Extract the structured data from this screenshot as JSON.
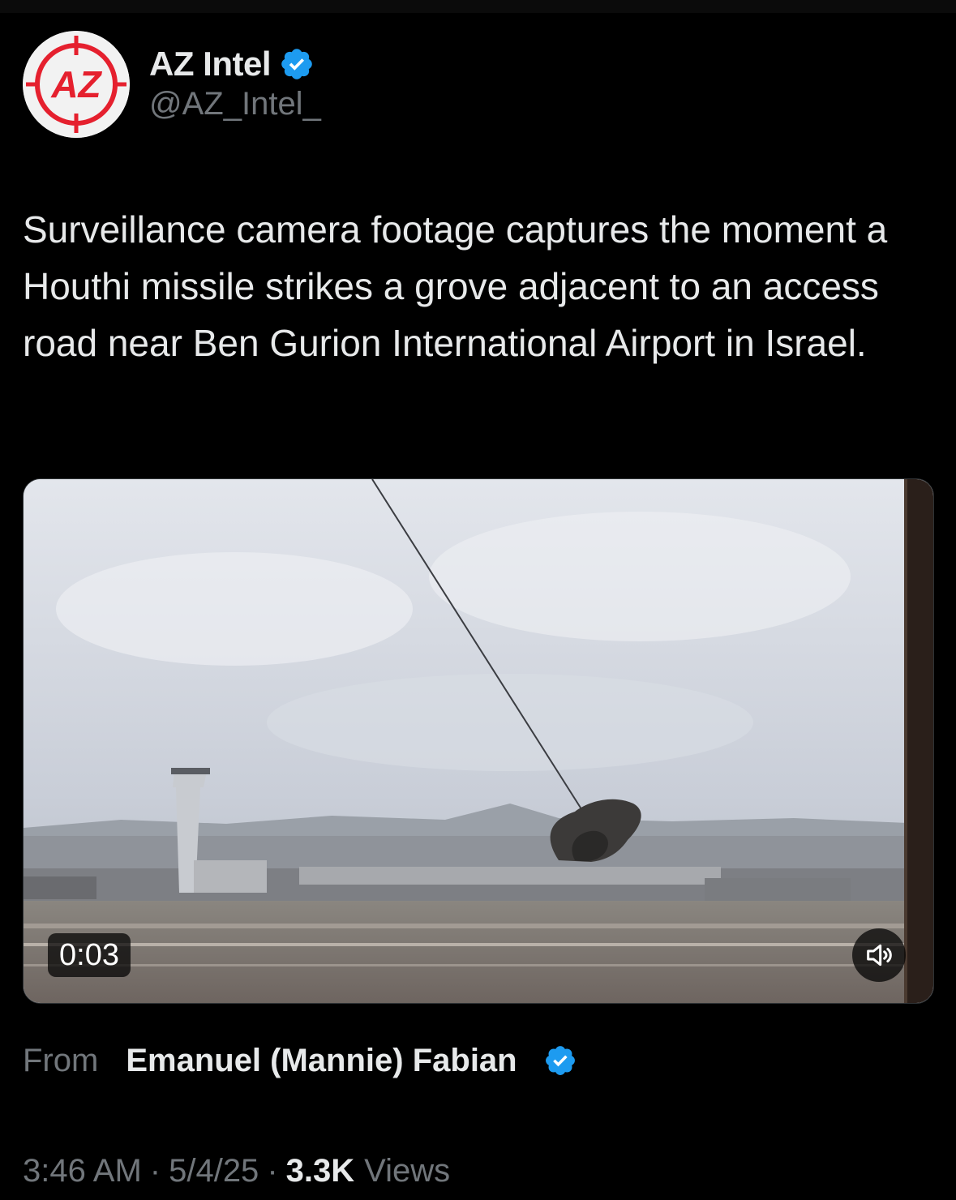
{
  "author": {
    "name": "AZ Intel",
    "handle": "@AZ_Intel_",
    "avatar_text": "AZ",
    "verified": true
  },
  "tweet": {
    "text": "Surveillance camera footage captures the moment a Houthi missile strikes a grove adjacent to an access road near Ben Gurion International Airport in Israel."
  },
  "media": {
    "type": "video",
    "duration": "0:03",
    "volume_icon": "volume-icon"
  },
  "source": {
    "from_label": "From",
    "name": "Emanuel (Mannie) Fabian",
    "verified": true
  },
  "meta": {
    "time": "3:46 AM",
    "separator": "·",
    "date": "5/4/25",
    "views_count": "3.3K",
    "views_label": "Views"
  },
  "colors": {
    "background": "#000000",
    "text_primary": "#e7e9ea",
    "text_secondary": "#71767b",
    "verified_blue": "#1d9bf0",
    "avatar_red": "#e5202e"
  }
}
